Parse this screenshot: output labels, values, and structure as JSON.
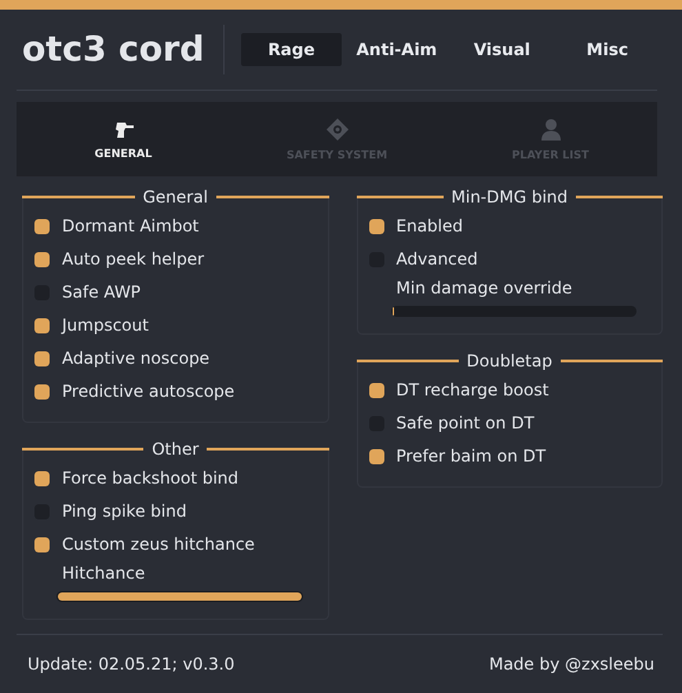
{
  "title": "otc3 cord",
  "tabs": [
    {
      "label": "Rage",
      "selected": true
    },
    {
      "label": "Anti-Aim",
      "selected": false
    },
    {
      "label": "Visual",
      "selected": false
    },
    {
      "label": "Misc",
      "selected": false
    }
  ],
  "subtabs": [
    {
      "label": "GENERAL",
      "selected": true
    },
    {
      "label": "SAFETY SYSTEM",
      "selected": false
    },
    {
      "label": "PLAYER LIST",
      "selected": false
    }
  ],
  "columns": [
    [
      {
        "title": "General",
        "items": [
          {
            "kind": "checkbox",
            "label": "Dormant Aimbot",
            "checked": true
          },
          {
            "kind": "checkbox",
            "label": "Auto peek helper",
            "checked": true
          },
          {
            "kind": "checkbox",
            "label": "Safe AWP",
            "checked": false
          },
          {
            "kind": "checkbox",
            "label": "Jumpscout",
            "checked": true
          },
          {
            "kind": "checkbox",
            "label": "Adaptive noscope",
            "checked": true
          },
          {
            "kind": "checkbox",
            "label": "Predictive autoscope",
            "checked": true
          }
        ]
      },
      {
        "title": "Other",
        "items": [
          {
            "kind": "checkbox",
            "label": "Force backshoot bind",
            "checked": true
          },
          {
            "kind": "checkbox",
            "label": "Ping spike bind",
            "checked": false
          },
          {
            "kind": "checkbox",
            "label": "Custom zeus hitchance",
            "checked": true
          },
          {
            "kind": "slider",
            "label": "Hitchance",
            "level": 1
          }
        ]
      }
    ],
    [
      {
        "title": "Min-DMG bind",
        "items": [
          {
            "kind": "checkbox",
            "label": "Enabled",
            "checked": true
          },
          {
            "kind": "checkbox",
            "label": "Advanced",
            "checked": false
          },
          {
            "kind": "slider",
            "label": "Min damage override",
            "level": 0.01
          }
        ]
      },
      {
        "title": "Doubletap",
        "items": [
          {
            "kind": "checkbox",
            "label": "DT recharge boost",
            "checked": true
          },
          {
            "kind": "checkbox",
            "label": "Safe point on DT",
            "checked": false
          },
          {
            "kind": "checkbox",
            "label": "Prefer baim on DT",
            "checked": true
          }
        ]
      }
    ]
  ],
  "footer": {
    "update": "Update: 02.05.21; v0.3.0",
    "credit": "Made by @zxsleebu"
  }
}
